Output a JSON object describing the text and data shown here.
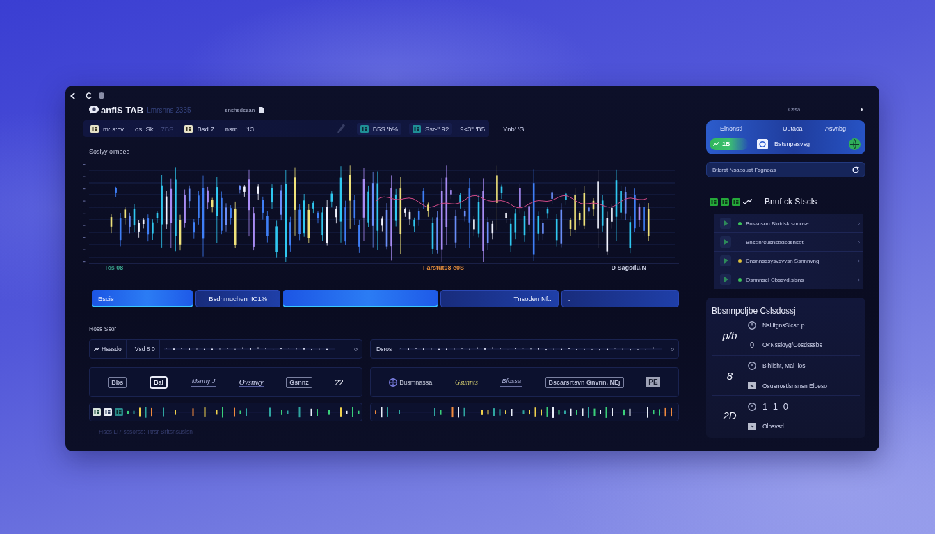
{
  "window": {
    "title": "anfiS TAB",
    "subtitle": "Lmrsnns 2335",
    "note": "snshsdsean"
  },
  "toolbar": {
    "items": [
      {
        "kind": "chip",
        "label": "m: s:cv",
        "disabled": false
      },
      {
        "kind": "text",
        "label": "os. Sk",
        "disabled": false
      },
      {
        "kind": "text",
        "label": "7BS",
        "disabled": true
      },
      {
        "kind": "chip",
        "label": "Bsd 7",
        "disabled": false
      },
      {
        "kind": "text",
        "label": "nsm",
        "disabled": false
      },
      {
        "kind": "text",
        "label": "'13",
        "disabled": false
      },
      {
        "kind": "pen",
        "disabled": true
      },
      {
        "kind": "chip",
        "label": "B5S 'b%",
        "disabled": false
      },
      {
        "kind": "chip",
        "label": "Ssr-'' 92",
        "disabled": false
      },
      {
        "kind": "text",
        "label": "9<3'' 'B5",
        "disabled": false
      }
    ],
    "status": "Ynb' 'G"
  },
  "chart": {
    "title": "Soslyy oimbec",
    "axis_labels": [
      {
        "label": "Tcs 08",
        "color": "#3aa08a"
      },
      {
        "label": "Farstut08 e0S",
        "color": "#e08a3a"
      },
      {
        "label": "D Sagsdu.N",
        "color": "#c8cce0"
      }
    ]
  },
  "segments": [
    {
      "label": "Bscis",
      "selected": true
    },
    {
      "label": "Bsdnmuchen IIC1%",
      "selected": false
    },
    {
      "selected": true
    },
    {
      "label": "Tnsoden Nf..",
      "selected": false
    },
    {
      "label": ".",
      "selected": false
    }
  ],
  "stats": {
    "title": "Ross Ssor",
    "panels": [
      {
        "kind": "with-icons",
        "chips": [
          {
            "kind": "trend",
            "label": "Hsasdo"
          },
          {
            "kind": "plain",
            "label": "Vsd 8 0"
          }
        ],
        "logos": [
          {
            "kind": "boxed",
            "label": "Bbs"
          },
          {
            "kind": "framed",
            "label": "Bal"
          },
          {
            "kind": "underlined",
            "label": "Msnny J"
          },
          {
            "kind": "script",
            "label": "Ovsnwy"
          },
          {
            "kind": "boxed",
            "label": "Gsnnz"
          },
          {
            "kind": "plain",
            "label": "22"
          }
        ]
      },
      {
        "kind": "plain",
        "chips": [
          {
            "kind": "label",
            "label": "Dsros"
          }
        ],
        "logos": [
          {
            "kind": "emblem",
            "label": "Busmnassa"
          },
          {
            "kind": "accent",
            "label": "Gsunnts"
          },
          {
            "kind": "underlined",
            "label": "Bfossa"
          },
          {
            "kind": "boxed",
            "label": "Bscarsrtsvn Gnvnn. NEj"
          },
          {
            "kind": "tile",
            "label": "PE"
          }
        ]
      }
    ],
    "footer": "Hscs LI7 sssorss: Ttrsr Brftsnsuslsn"
  },
  "sidebar": {
    "corner_label": "Cssa",
    "summary": {
      "columns": [
        "Elnonstl",
        "Uutaca",
        "Asvnbg"
      ],
      "badge": "1B",
      "name": "Bstsnpasvsg"
    },
    "search": {
      "value": "Btlcrst Nsaboust Fsgnoas"
    },
    "watchlist": {
      "title": "Bnuf ck Stscls",
      "items": [
        {
          "label": "Bnsscsun Bloidsk snnnse",
          "color": "#3cc25a"
        },
        {
          "label": "Bnsdnrcusnsbdsdsnsbt"
        },
        {
          "label": "Cnsnnsssysvsvvsn Ssnnnvng",
          "color": "#e0c23c"
        },
        {
          "label": "Osnnnsel Cbssvd.sisns",
          "color": "#3cc25a"
        }
      ]
    },
    "details": {
      "title": "Bbsnnpoljbe Cslsdossj",
      "rows": [
        {
          "kind": "text",
          "value": "p/b",
          "lines": [
            {
              "text": "NsUtgnsSlcsn p"
            },
            {
              "prefix": "0",
              "text": "O<Nssloyg/Cosdsssbs"
            }
          ]
        },
        {
          "kind": "text",
          "value": "8",
          "lines": [
            {
              "text": "Bihlisht, Mal_los"
            },
            {
              "text": "Osusnostlsnsnsn Eloeso"
            }
          ]
        },
        {
          "kind": "reading",
          "value": "2D",
          "lines": [
            {
              "text": "1 1 0"
            },
            {
              "text": "Olnsvsd"
            }
          ]
        }
      ]
    }
  }
}
